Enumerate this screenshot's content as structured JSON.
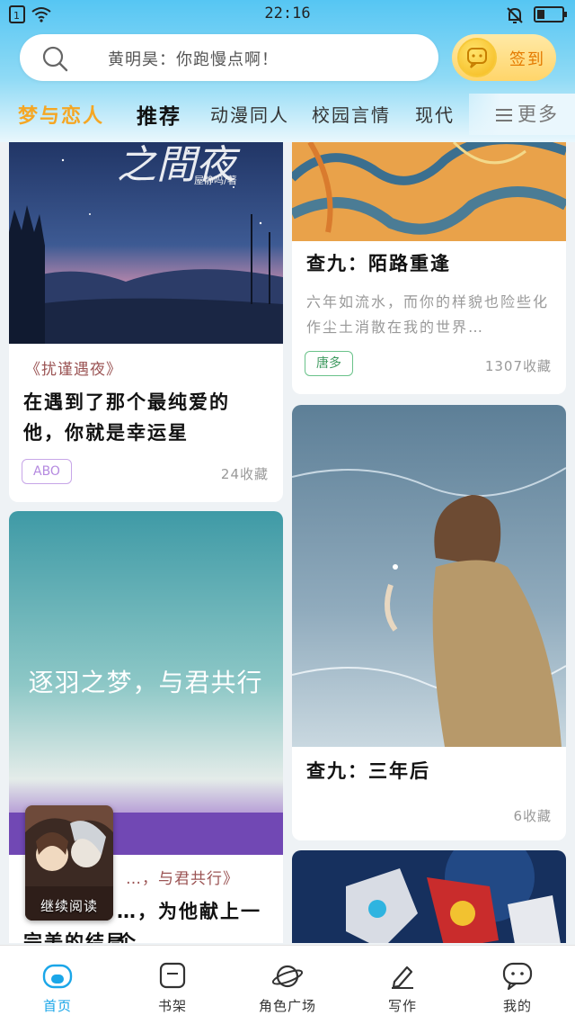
{
  "status_bar": {
    "time": "22:16"
  },
  "search": {
    "placeholder": "黄明昊：你跑慢点啊！"
  },
  "checkin": {
    "label": "签到"
  },
  "tabs": {
    "brand": "梦与恋人",
    "items": [
      "推荐",
      "动漫同人",
      "校园言情",
      "现代"
    ],
    "more": "更多"
  },
  "cards": {
    "left1": {
      "cover_text": "屋静吗/著",
      "series": "《扰谨遇夜》",
      "title": "在遇到了那个最纯爱的他，你就是幸运星",
      "tag": "ABO",
      "favorites": "24收藏"
    },
    "right1": {
      "title": "查九：陌路重逢",
      "excerpt": "六年如流水，而你的样貌也险些化作尘土消散在我的世界…",
      "tag": "唐多",
      "favorites": "1307收藏"
    },
    "right2": {
      "title": "查九：三年后",
      "favorites": "6收藏"
    },
    "left2": {
      "cover_text": "逐羽之梦，与君共行",
      "series": "…，与君共行》",
      "title": "…，为他献上一个",
      "title2": "完美的结局"
    }
  },
  "floating_widget": {
    "label": "继续阅读"
  },
  "bottom_nav": [
    {
      "label": "首页",
      "icon": "home-icon",
      "active": true
    },
    {
      "label": "书架",
      "icon": "bookshelf-icon",
      "active": false
    },
    {
      "label": "角色广场",
      "icon": "planet-icon",
      "active": false
    },
    {
      "label": "写作",
      "icon": "pen-icon",
      "active": false
    },
    {
      "label": "我的",
      "icon": "chat-face-icon",
      "active": false
    }
  ],
  "colors": {
    "accent": "#1aa6e8",
    "brand": "#f5a623",
    "header_top": "#56c6f3"
  }
}
